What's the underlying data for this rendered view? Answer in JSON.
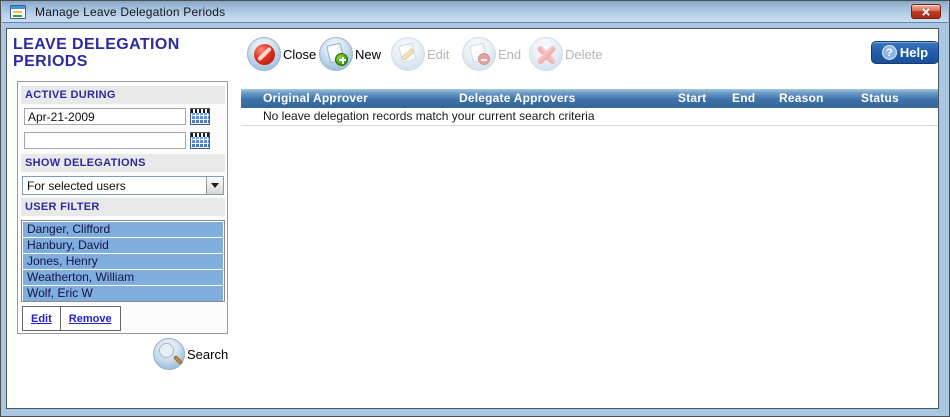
{
  "window": {
    "title": "Manage Leave Delegation Periods"
  },
  "sidebar": {
    "heading_line1": "LEAVE DELEGATION",
    "heading_line2": "PERIODS",
    "active_during": {
      "label": "ACTIVE DURING",
      "from_value": "Apr-21-2009",
      "to_value": ""
    },
    "show_delegations": {
      "label": "SHOW DELEGATIONS",
      "selected_option": "For selected users"
    },
    "user_filter": {
      "label": "USER FILTER",
      "users": [
        "Danger, Clifford",
        "Hanbury, David",
        "Jones, Henry",
        "Weatherton, William",
        "Wolf, Eric W"
      ],
      "edit_link": "Edit",
      "remove_link": "Remove"
    },
    "search_label": "Search"
  },
  "toolbar": {
    "close_label": "Close",
    "new_label": "New",
    "edit_label": "Edit",
    "end_label": "End",
    "delete_label": "Delete",
    "help_label": "Help",
    "help_glyph": "?",
    "disabled_buttons": [
      "Edit",
      "End",
      "Delete"
    ]
  },
  "table": {
    "columns": [
      "Original Approver",
      "Delegate Approvers",
      "Start",
      "End",
      "Reason",
      "Status"
    ],
    "empty_message": "No leave delegation records match your current search criteria"
  },
  "icons": {
    "titlebar": "form-window-icon",
    "close_window": "close-x-icon",
    "close_action": "no-entry-icon",
    "new_action": "document-plus-icon",
    "edit_action": "document-pencil-icon",
    "end_action": "document-stop-icon",
    "delete_action": "red-x-icon",
    "help": "question-circle-icon",
    "calendar": "calendar-icon",
    "search": "magnifier-icon",
    "dropdown": "chevron-down-icon"
  },
  "colors": {
    "heading_text": "#2b2ba1",
    "grid_header_blue": "#3d72a8",
    "list_item_blue": "#7faddd",
    "help_button_blue": "#1f5aa8",
    "titlebar_blue": "#b6cfe8",
    "close_button_red": "#bc3a24"
  }
}
